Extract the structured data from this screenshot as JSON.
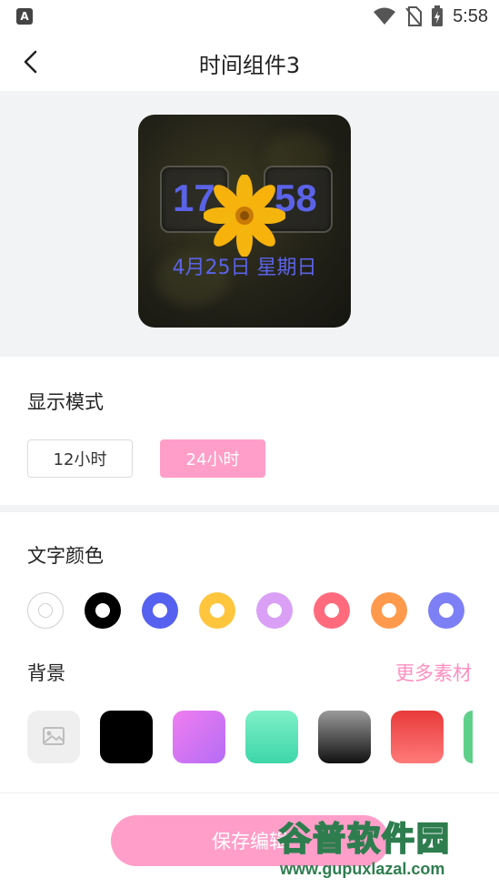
{
  "status_bar": {
    "left_icon": "A",
    "time": "5:58",
    "icons": [
      "wifi-icon",
      "no-sim-icon",
      "battery-charging-icon"
    ]
  },
  "header": {
    "title": "时间组件3",
    "back_icon": "chevron-left-icon"
  },
  "preview": {
    "hour": "17",
    "colon": ":",
    "minute": "58",
    "date_text": "4月25日  星期日",
    "text_color": "#5a63e8"
  },
  "display_mode": {
    "label": "显示模式",
    "options": [
      "12小时",
      "24小时"
    ],
    "selected": "24小时"
  },
  "text_color": {
    "label": "文字颜色",
    "swatches": [
      "#ffffff",
      "#000000",
      "#5661f0",
      "#ffc53d",
      "#d9a0f5",
      "#ff6b7d",
      "#ff9a4d",
      "#7d7ff5"
    ],
    "selected_index": 0
  },
  "background": {
    "label": "背景",
    "more_label": "更多素材",
    "tiles": [
      "image-placeholder",
      "#000000",
      "violet-gradient",
      "mint-gradient",
      "gray-black-gradient",
      "red-gradient",
      "green-gradient"
    ]
  },
  "actions": {
    "save_label": "保存编辑"
  },
  "watermark": {
    "top": "谷普软件园",
    "bottom": "www.gupuxlazal.com"
  },
  "colors": {
    "accent_pink": "#ff9ec8",
    "clock_blue": "#5a63e8"
  }
}
